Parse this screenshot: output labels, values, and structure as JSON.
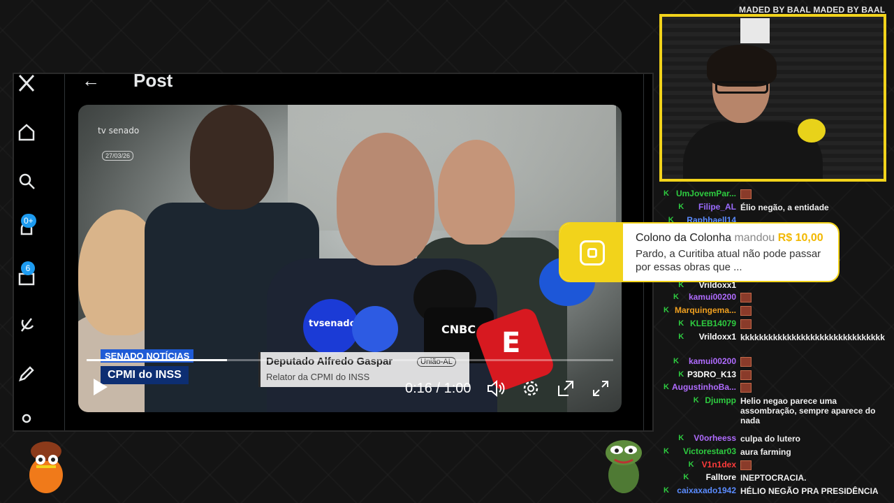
{
  "webcam": {
    "title": "MADED BY BAAL MADED BY BAAL"
  },
  "post": {
    "title": "Post",
    "back_icon": "arrow-left-icon"
  },
  "nav": {
    "badges": [
      "0+",
      "6"
    ],
    "icons": [
      "x-logo-icon",
      "home-icon",
      "search-icon",
      "notifications-icon",
      "messages-icon",
      "grok-icon",
      "write-icon",
      "profile-icon"
    ]
  },
  "video": {
    "channel": "tv senado",
    "date": "27/03/26",
    "tag": "SENADO NOTÍCIAS",
    "topic": "CPMI do INSS",
    "speaker": "Deputado Alfredo Gaspar",
    "party": "União-AL",
    "role": "Relator da CPMI do INSS",
    "mic_labels": [
      "tvsenado",
      "CNBC",
      "E"
    ],
    "time": "0:16 / 1:00",
    "progress": 0.267
  },
  "donation": {
    "user": "Colono da Colonha",
    "action": "mandou",
    "amount": "R$ 10,00",
    "message": "Pardo, a Curitiba atual não pode passar por essas obras que ...",
    "accent": "#f2d31b"
  },
  "chat": {
    "messages": [
      {
        "user": "UmJovemPar...",
        "color": "#2ecc40",
        "text": "",
        "emote": true
      },
      {
        "user": "Filipe_AL",
        "color": "#9b6bff",
        "text": "Élio negão, a entidade",
        "emote": false
      },
      {
        "user": "Raphhaell14",
        "color": "#5b8cff",
        "text": "",
        "emote": false
      },
      {
        "user": "",
        "color": "#ffffff",
        "text": "true",
        "emote": false
      },
      {
        "user": "Vrildoxx1",
        "color": "#ffffff",
        "text": "",
        "emote": false
      },
      {
        "user": "kamui00200",
        "color": "#b06cff",
        "text": "",
        "emote": true
      },
      {
        "user": "Marquingema...",
        "color": "#f0a020",
        "text": "",
        "emote": true
      },
      {
        "user": "KLEB14079",
        "color": "#2ecc40",
        "text": "",
        "emote": true
      },
      {
        "user": "Vrildoxx1",
        "color": "#ffffff",
        "text": "kkkkkkkkkkkkkkkkkkkkkkkkkkkkkkk",
        "emote": false
      },
      {
        "user": "kamui00200",
        "color": "#b06cff",
        "text": "",
        "emote": true
      },
      {
        "user": "P3DRO_K13",
        "color": "#ffffff",
        "text": "",
        "emote": true
      },
      {
        "user": "AugustinhoBa...",
        "color": "#b06cff",
        "text": "",
        "emote": true
      },
      {
        "user": "Djumpp",
        "color": "#2ecc40",
        "text": "Helio negao parece uma assombração, sempre aparece do nada",
        "emote": false
      },
      {
        "user": "V0orheess",
        "color": "#b06cff",
        "text": "culpa do lutero",
        "emote": false
      },
      {
        "user": "Victorestar03",
        "color": "#2ecc40",
        "text": "aura farming",
        "emote": false
      },
      {
        "user": "V1n1dex",
        "color": "#ff3b3b",
        "text": "",
        "emote": true
      },
      {
        "user": "Falltore",
        "color": "#ffffff",
        "text": "INEPTOCRACIA.",
        "emote": false
      },
      {
        "user": "caixaxado1942",
        "color": "#5b8cff",
        "text": "HÉLIO NEGÃO PRA PRESIDÊNCIA",
        "emote": false
      }
    ]
  }
}
